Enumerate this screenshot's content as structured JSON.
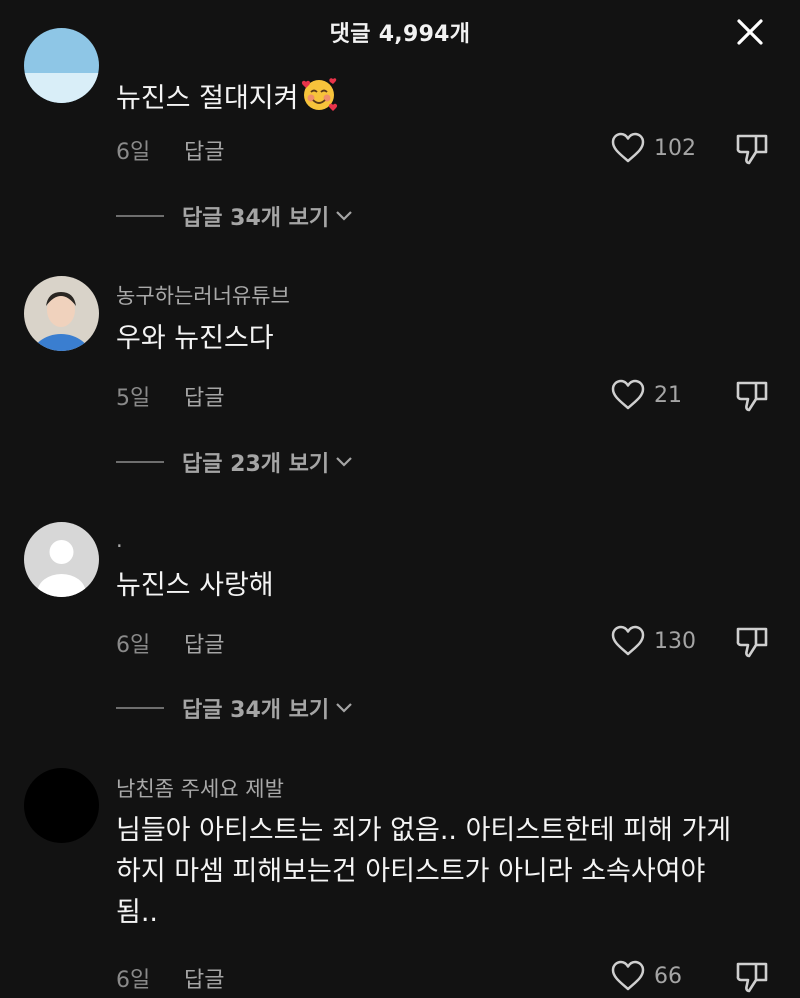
{
  "header": {
    "title": "댓글 4,994개"
  },
  "reply_label": "답글",
  "comments": [
    {
      "username": "",
      "text": "뉴진스 절대지켜",
      "emoji": "smiling-face-with-hearts",
      "time": "6일",
      "likes": "102",
      "view_replies": "답글 34개 보기"
    },
    {
      "username": "농구하는러너유튜브",
      "text": "우와 뉴진스다",
      "time": "5일",
      "likes": "21",
      "view_replies": "답글 23개 보기"
    },
    {
      "username": ".",
      "text": "뉴진스 사랑해",
      "time": "6일",
      "likes": "130",
      "view_replies": "답글 34개 보기"
    },
    {
      "username": "남친좀 주세요 제발",
      "text_lines": [
        "님들아 아티스트는 죄가 없음.. 아티스트한테 피해 가게",
        "하지 마셈 피해보는건 아티스트가 아니라 소속사여야",
        "됨.."
      ],
      "time": "6일",
      "likes": "66"
    }
  ],
  "colors": {
    "background": "#121212",
    "text": "#f4f4f4",
    "muted": "#a5a5a5"
  }
}
